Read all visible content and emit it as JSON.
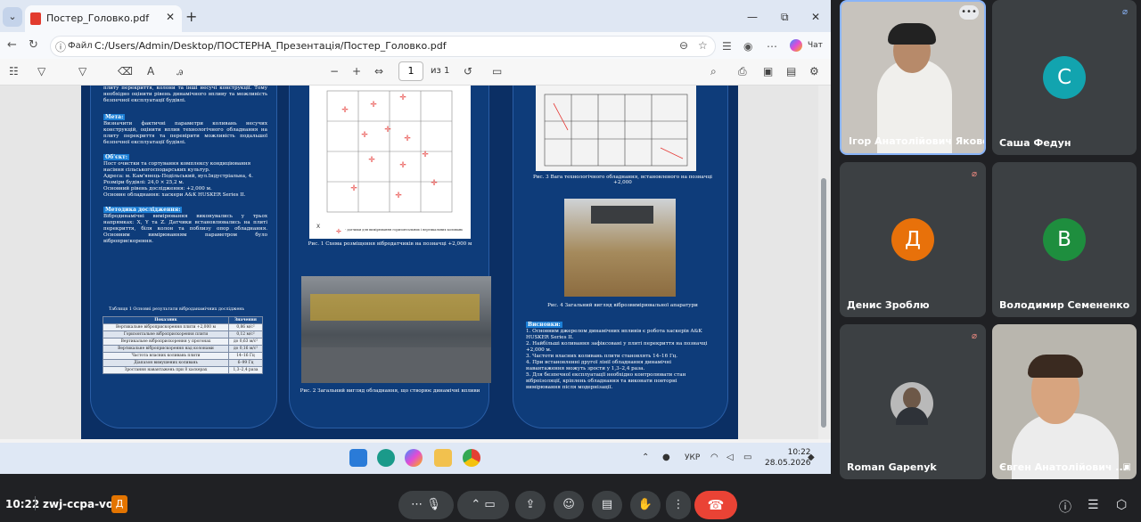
{
  "browser": {
    "tab_title": "Постер_Головко.pdf",
    "address_label": "Файл",
    "url": "C:/Users/Admin/Desktop/ПОСТЕРНА_Презентація/Постер_Головко.pdf",
    "chat_label": "Чат",
    "page_current": "1",
    "page_of": "из 1"
  },
  "poster": {
    "col1": {
      "intro": "плиту перекриття, колони та інші несучі конструкції. Тому необхідно оцінити рівень динамічного впливу та можливість безпечної експлуатації будівлі.",
      "goal_title": "Мета:",
      "goal_text": "Визначити фактичні параметри коливань несучих конструкцій, оцінити вплив технологічного обладнання на плиту перекриття та перевірити можливість подальшої безпечної експлуатації будівлі.",
      "object_title": "Об'єкт:",
      "object_text": "Пост очистки та сортування комплексу кондиціювання насіння сільськогосподарських культур.",
      "address": "Адреса: м. Кам'янець-Подільський, вул.Індустріальна, 4.",
      "size": "Розміри будівлі: 24,0 × 25,2 м.",
      "level": "Основний рівень дослідження: +2,000 м.",
      "equipment": "Основне обладнання: хаскери A&K HUSKER Series II.",
      "method_title": "Методика дослідження:",
      "method_text": "Вібродинамічні вимірювання виконувались у трьох напрямках: X, Y та Z. Датчики встановлювались на плиті перекриття, біля колон та поблизу опор обладнання. Основним вимірюванням параметром було віброприскорення.",
      "table_title": "Таблиця 1 Основні результати віброданамічних досліджень",
      "table_header": [
        "Показник",
        "Значення"
      ],
      "table_rows": [
        [
          "Вертикальне віброприскорення плити +2,000 м",
          "0,86 м/с²"
        ],
        [
          "Горизонтальне віброприскорення плити",
          "0,12 м/с²"
        ],
        [
          "Вертикальне віброприскорення у прогонах",
          "до 0,63 м/с²"
        ],
        [
          "Вертикальне віброприскорення над колонами",
          "до 0,16 м/с²"
        ],
        [
          "Частота власних коливань плити",
          "14–16 Гц"
        ],
        [
          "Діапазон вимушених коливань",
          "6–99 Гц"
        ],
        [
          "Зростання навантажень при 8 хаскерах",
          "1,3–2,4 раза"
        ]
      ]
    },
    "col2": {
      "fig1_caption": "Рис. 1 Схема розміщення вібродатчиків на позначці +2,000 м",
      "fig1_legend": "- датчики для вимірювання горизонтальних і вертикальних коливань",
      "fig2_caption": "Рис. 2 Загальний вигляд обладнання, що створює динамічні впливи"
    },
    "col3": {
      "fig3_caption": "Рис. 3 Вага технологічного обладнання, встановленого на позначці +2,000",
      "fig4_caption": "Рис. 4 Загальний вигляд віброзвимірювальної апаратури",
      "conclusions_title": "Висновки:",
      "conclusions": [
        "1. Основним джерелом динамічних впливів є робота хаскерів A&K HUSKER Series II.",
        "2. Найбільші коливання зафіксовані у плиті перекриття на позначці +2,000 м.",
        "3. Частоти власних коливань плити становлять 14–16 Гц.",
        "4. При встановленні другої лінії обладнання динамічні навантаження можуть зрости у 1,3–2,4 раза.",
        "5. Для безпечної експлуатації необхідно контролювати стан віброізоляції, кріплень обладнання та виконати повторні вимірювання після модернізації."
      ]
    }
  },
  "taskbar": {
    "lang": "УКР",
    "time": "10:22",
    "date": "28.05.2026"
  },
  "participants": [
    {
      "name": "Ігор Анатолійович Якове...",
      "type": "video"
    },
    {
      "name": "Саша Федун",
      "initial": "С",
      "color": "#12a4af"
    },
    {
      "name": "Денис Зроблю",
      "initial": "Д",
      "color": "#e8710a"
    },
    {
      "name": "Володимир Семененко",
      "initial": "В",
      "color": "#1e8e3e"
    },
    {
      "name": "Roman Gapenyk",
      "type": "photo"
    },
    {
      "name": "Євген Анатолійович ...",
      "type": "video"
    }
  ],
  "meet": {
    "time": "10:22",
    "code": "zwj-ccpa-vot",
    "app_badge": "Д"
  }
}
